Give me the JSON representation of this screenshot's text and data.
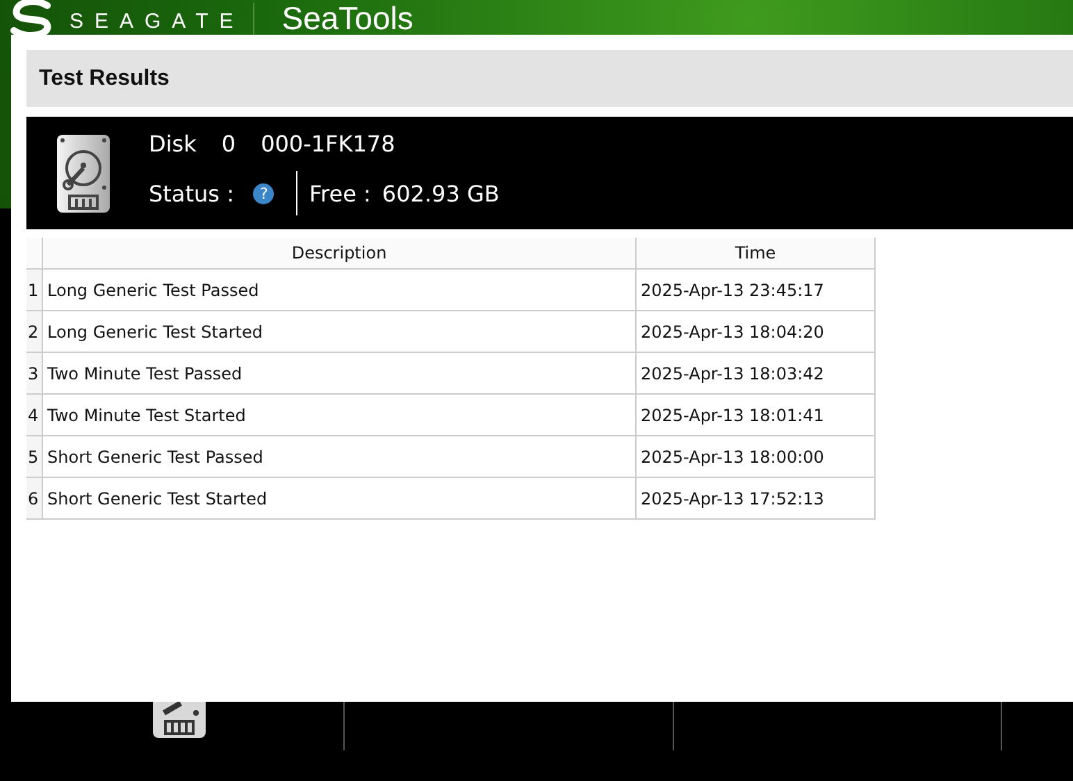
{
  "app_header": {
    "brand": "SEAGATE",
    "product": "SeaTools"
  },
  "dialog": {
    "title": "Test Results",
    "disk": {
      "label": "Disk",
      "index": "0",
      "model": "000-1FK178",
      "status_label": "Status :",
      "status_icon": "?",
      "free_label": "Free :",
      "free_value": "602.93 GB"
    },
    "table": {
      "columns": [
        "Description",
        "Time"
      ],
      "rows": [
        {
          "number": "1",
          "description": "Long Generic Test Passed",
          "time": "2025-Apr-13 23:45:17"
        },
        {
          "number": "2",
          "description": "Long Generic Test Started",
          "time": "2025-Apr-13 18:04:20"
        },
        {
          "number": "3",
          "description": "Two Minute Test Passed",
          "time": "2025-Apr-13 18:03:42"
        },
        {
          "number": "4",
          "description": "Two Minute Test Started",
          "time": "2025-Apr-13 18:01:41"
        },
        {
          "number": "5",
          "description": "Short Generic Test Passed",
          "time": "2025-Apr-13 18:00:00"
        },
        {
          "number": "6",
          "description": "Short Generic Test Started",
          "time": "2025-Apr-13 17:52:13"
        }
      ]
    }
  }
}
